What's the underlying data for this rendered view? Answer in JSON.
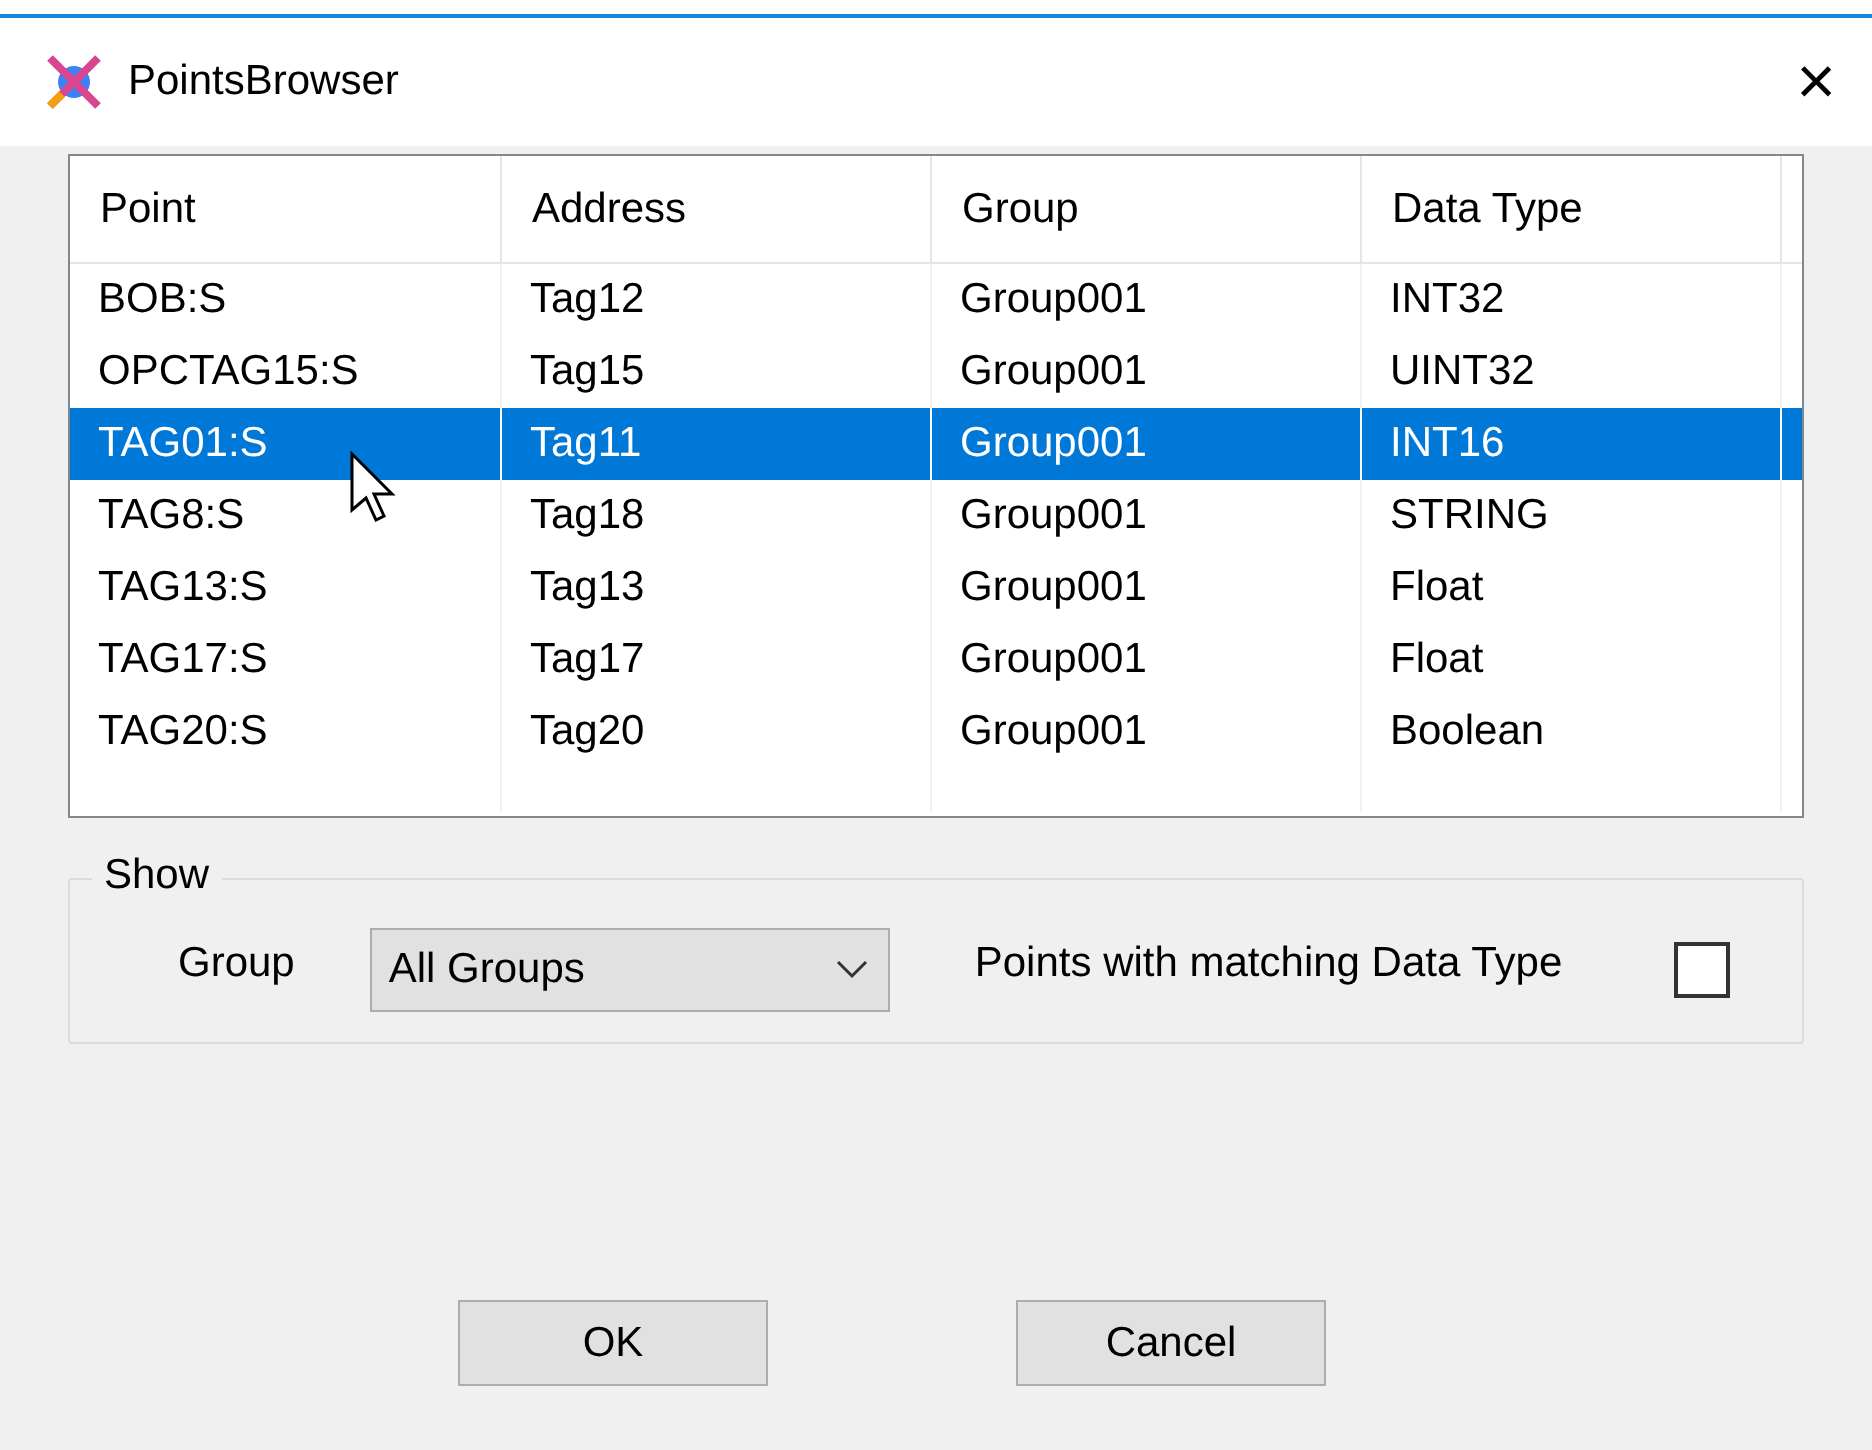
{
  "window": {
    "title": "PointsBrowser",
    "close": "×"
  },
  "table": {
    "columns": [
      "Point",
      "Address",
      "Group",
      "Data Type"
    ],
    "rows": [
      {
        "cells": [
          "BOB:S",
          "Tag12",
          "Group001",
          "INT32"
        ],
        "selected": false
      },
      {
        "cells": [
          "OPCTAG15:S",
          "Tag15",
          "Group001",
          "UINT32"
        ],
        "selected": false
      },
      {
        "cells": [
          "TAG01:S",
          "Tag11",
          "Group001",
          "INT16"
        ],
        "selected": true
      },
      {
        "cells": [
          "TAG8:S",
          "Tag18",
          "Group001",
          "STRING"
        ],
        "selected": false
      },
      {
        "cells": [
          "TAG13:S",
          "Tag13",
          "Group001",
          "Float"
        ],
        "selected": false
      },
      {
        "cells": [
          "TAG17:S",
          "Tag17",
          "Group001",
          "Float"
        ],
        "selected": false
      },
      {
        "cells": [
          "TAG20:S",
          "Tag20",
          "Group001",
          "Boolean"
        ],
        "selected": false
      }
    ]
  },
  "show": {
    "title": "Show",
    "group_label": "Group",
    "group_value": "All Groups",
    "match_label": "Points with matching Data Type",
    "match_checked": false
  },
  "buttons": [
    "OK",
    "Cancel"
  ]
}
